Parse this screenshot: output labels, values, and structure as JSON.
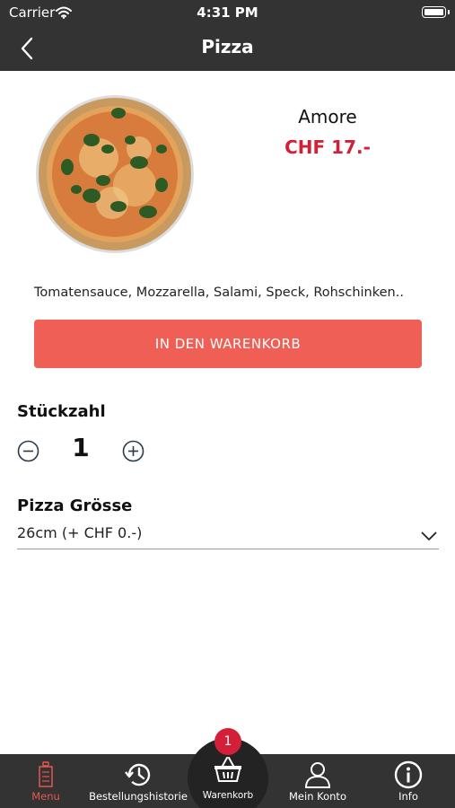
{
  "status_bar": {
    "carrier": "Carrier",
    "time": "4:31 PM"
  },
  "nav": {
    "title": "Pizza",
    "back_icon": "chevron-left-icon"
  },
  "product": {
    "name": "Amore",
    "price": "CHF 17.-",
    "description": "Tomatensauce, Mozzarella, Salami, Speck, Rohschinken..",
    "add_to_cart_label": "IN DEN WARENKORB"
  },
  "quantity": {
    "label": "Stückzahl",
    "value": "1"
  },
  "size": {
    "label": "Pizza Grösse",
    "selected": "26cm (+ CHF 0.-)"
  },
  "tab_bar": {
    "menu": "Menu",
    "history": "Bestellungshistorie",
    "cart": "Warenkorb",
    "cart_badge": "1",
    "account": "Mein Konto",
    "info": "Info"
  },
  "colors": {
    "bar_background": "#333333",
    "accent_red": "#d32038",
    "button_coral": "#f05f55",
    "active_tab": "#e8564c"
  }
}
